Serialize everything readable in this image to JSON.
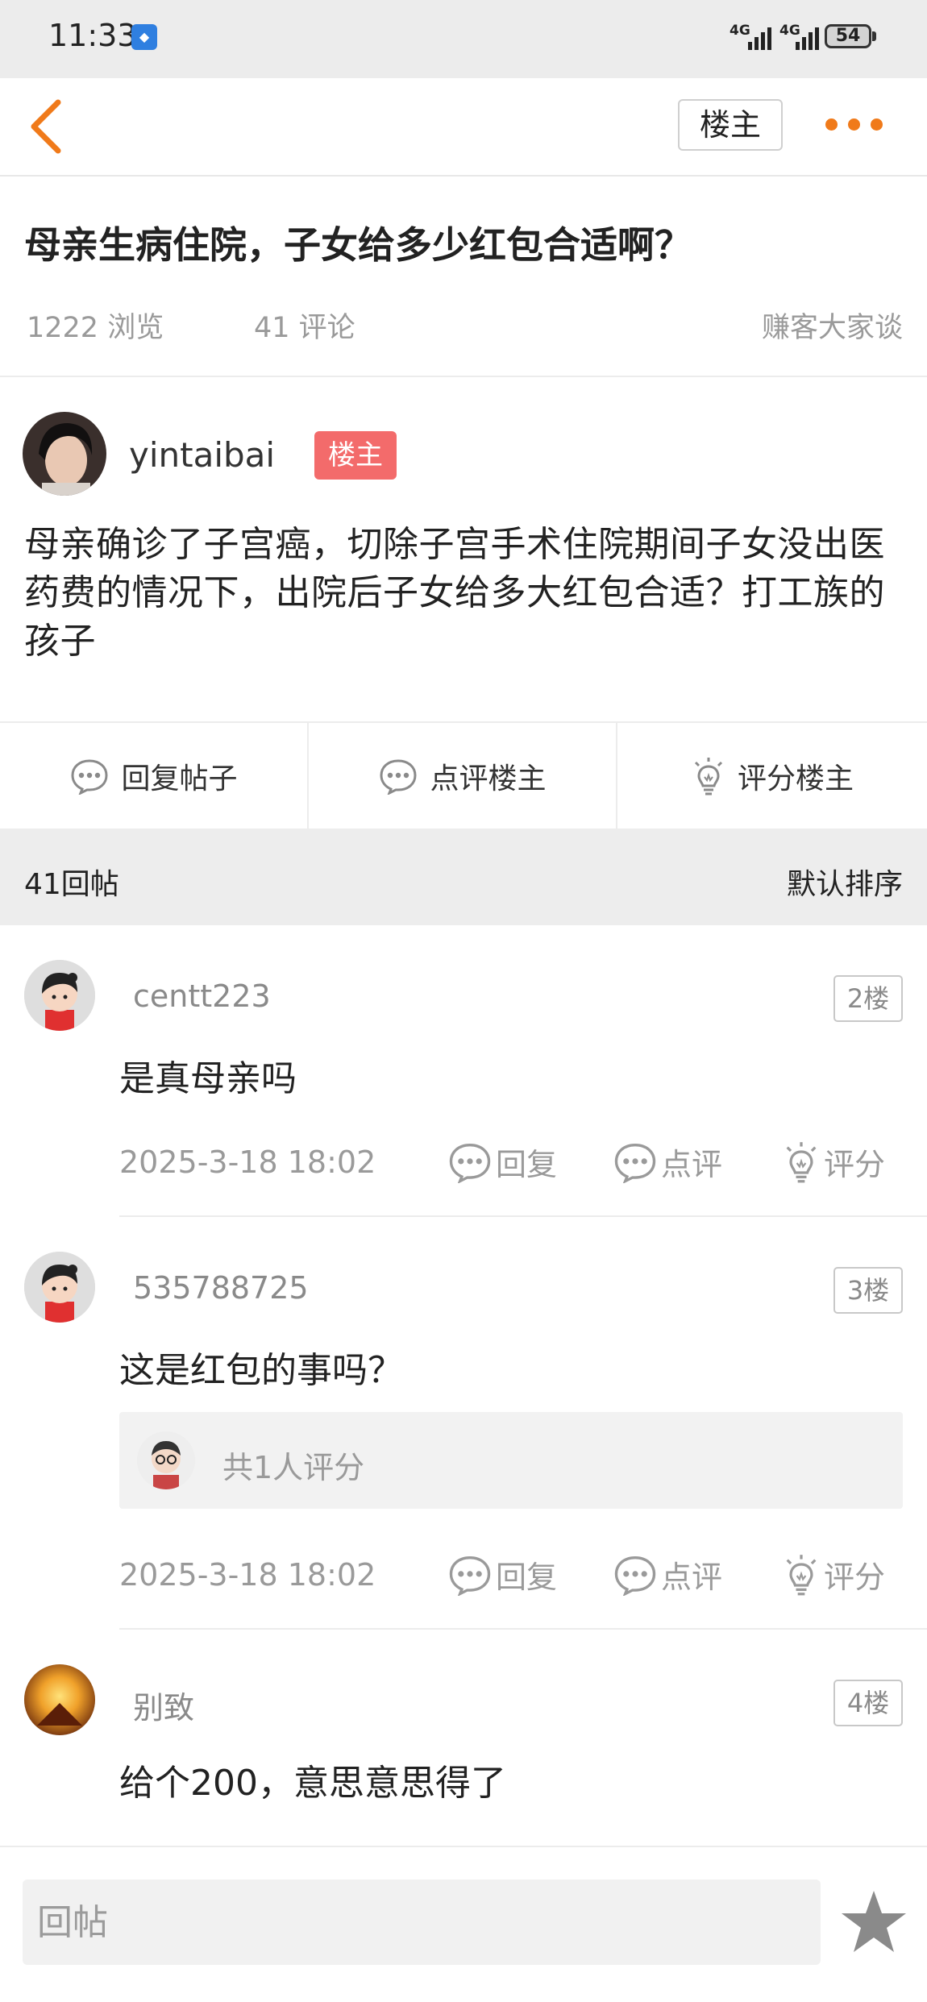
{
  "status_bar": {
    "time": "11:33",
    "network_1": "4G",
    "network_2": "4G",
    "battery": "54"
  },
  "nav": {
    "op_filter_label": "楼主"
  },
  "post": {
    "title": "母亲生病住院，子女给多少红包合适啊？",
    "views": "1222 浏览",
    "comments": "41 评论",
    "forum": "赚客大家谈",
    "author": "yintaibai",
    "author_badge": "楼主",
    "body": "母亲确诊了子宫癌，切除子宫手术住院期间子女没出医药费的情况下，出院后子女给多大红包合适？打工族的孩子"
  },
  "actions": {
    "reply": "回复帖子",
    "comment_op": "点评楼主",
    "rate_op": "评分楼主"
  },
  "replies_header": {
    "count": "41回帖",
    "sort": "默认排序"
  },
  "comments": [
    {
      "user": "centt223",
      "floor": "2楼",
      "text": "是真母亲吗",
      "time": "2025-3-18 18:02",
      "reply": "回复",
      "review": "点评",
      "rate": "评分"
    },
    {
      "user": "535788725",
      "floor": "3楼",
      "text": "这是红包的事吗？",
      "rating_summary": "共1人评分",
      "time": "2025-3-18 18:02",
      "reply": "回复",
      "review": "点评",
      "rate": "评分"
    },
    {
      "user": "别致",
      "floor": "4楼",
      "text": "给个200，意思意思得了"
    }
  ],
  "bottom_bar": {
    "reply_placeholder": "回帖"
  },
  "colors": {
    "accent": "#f07a1a",
    "badge": "#f36b6b",
    "muted": "#9a9a9a"
  }
}
